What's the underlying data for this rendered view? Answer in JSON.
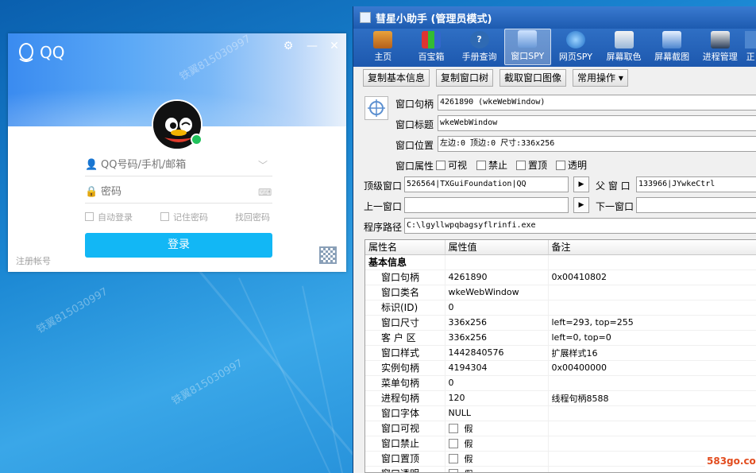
{
  "watermark": "铁翼815030997",
  "qq": {
    "brand": "QQ",
    "account_placeholder": "QQ号码/手机/邮箱",
    "password_placeholder": "密码",
    "auto_login": "自动登录",
    "remember_pwd": "记住密码",
    "find_pwd": "找回密码",
    "login_button": "登录",
    "register": "注册帐号"
  },
  "helper": {
    "title": "彗星小助手 (管理员模式)",
    "toolbar": [
      "主页",
      "百宝箱",
      "手册查询",
      "窗口SPY",
      "网页SPY",
      "屏幕取色",
      "屏幕截图",
      "进程管理",
      "正"
    ],
    "buttons": [
      "复制基本信息",
      "复制窗口树",
      "截取窗口图像",
      "常用操作"
    ],
    "labels": {
      "handle": "窗口句柄",
      "title": "窗口标题",
      "position": "窗口位置",
      "attrs": "窗口属性",
      "top": "顶级窗口",
      "parent": "父 窗 口",
      "prev": "上一窗口",
      "next": "下一窗口",
      "path": "程序路径"
    },
    "values": {
      "handle": "4261890 (wkeWebWindow)",
      "title": "wkeWebWindow",
      "position": "左边:0 顶边:0 尺寸:336x256",
      "top": "526564|TXGuiFoundation|QQ",
      "parent": "133966|JYwkeCtrl",
      "prev": "",
      "next": "",
      "path": "C:\\lgyllwpqbagsyflrinfi.exe"
    },
    "attr_checks": [
      "可视",
      "禁止",
      "置顶",
      "透明"
    ],
    "grid_headers": [
      "属性名",
      "属性值",
      "备注"
    ],
    "grid_group": "基本信息",
    "grid_rows": [
      {
        "name": "窗口句柄",
        "value": "4261890",
        "note": "0x00410802",
        "check": false
      },
      {
        "name": "窗口类名",
        "value": "wkeWebWindow",
        "note": "",
        "check": false
      },
      {
        "name": "标识(ID)",
        "value": "0",
        "note": "",
        "check": false
      },
      {
        "name": "窗口尺寸",
        "value": "336x256",
        "note": "left=293, top=255",
        "check": false
      },
      {
        "name": "客 户 区",
        "value": "336x256",
        "note": "left=0, top=0",
        "check": false
      },
      {
        "name": "窗口样式",
        "value": "1442840576",
        "note": "扩展样式16",
        "check": false
      },
      {
        "name": "实例句柄",
        "value": "4194304",
        "note": "0x00400000",
        "check": false
      },
      {
        "name": "菜单句柄",
        "value": "0",
        "note": "",
        "check": false
      },
      {
        "name": "进程句柄",
        "value": "120",
        "note": "线程句柄8588",
        "check": false
      },
      {
        "name": "窗口字体",
        "value": "NULL",
        "note": "",
        "check": false
      },
      {
        "name": "窗口可视",
        "value": "假",
        "note": "",
        "check": true
      },
      {
        "name": "窗口禁止",
        "value": "假",
        "note": "",
        "check": true
      },
      {
        "name": "窗口置顶",
        "value": "假",
        "note": "",
        "check": true
      },
      {
        "name": "窗口透明",
        "value": "假",
        "note": "",
        "check": true
      }
    ]
  },
  "site_mark": "583go.com"
}
